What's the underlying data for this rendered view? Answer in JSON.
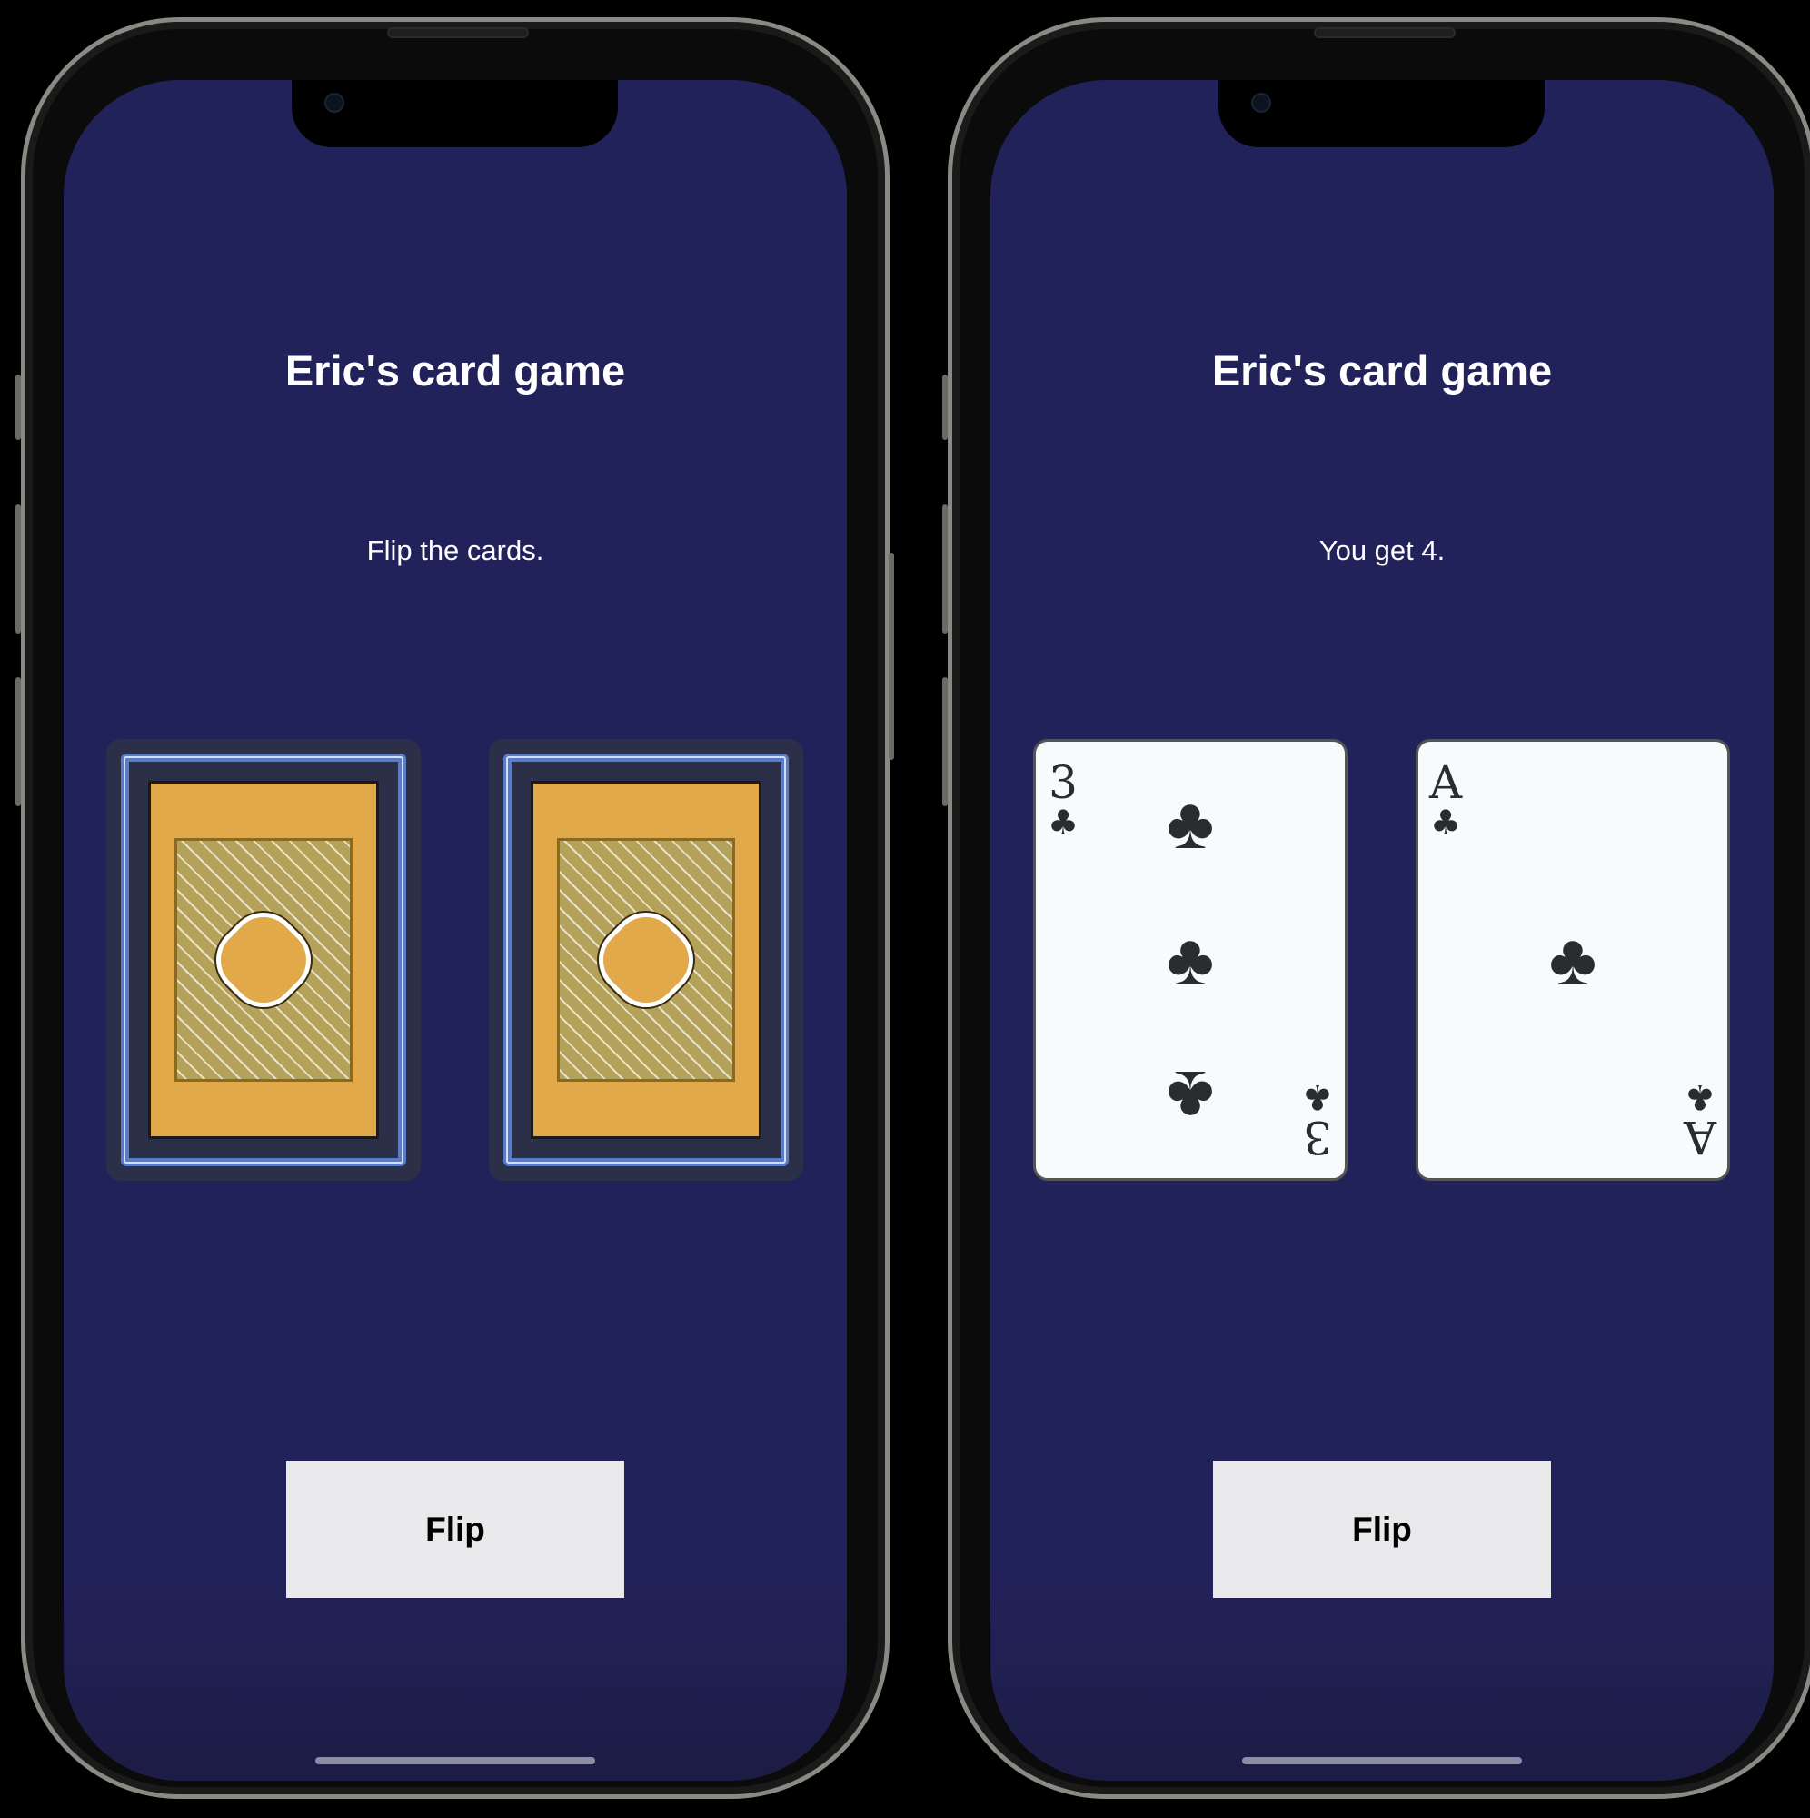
{
  "screens": [
    {
      "title": "Eric's card game",
      "message": "Flip the cards.",
      "button_label": "Flip",
      "cards": [
        {
          "state": "face-down"
        },
        {
          "state": "face-down"
        }
      ]
    },
    {
      "title": "Eric's card game",
      "message": "You get 4.",
      "button_label": "Flip",
      "cards": [
        {
          "state": "face-up",
          "rank": "3",
          "suit": "♣"
        },
        {
          "state": "face-up",
          "rank": "A",
          "suit": "♣"
        }
      ]
    }
  ],
  "colors": {
    "screen_bg": "#22225a",
    "button_bg": "#e9e8ea",
    "card_gold": "#e2a94a",
    "card_rope": "#5a7cc4"
  }
}
